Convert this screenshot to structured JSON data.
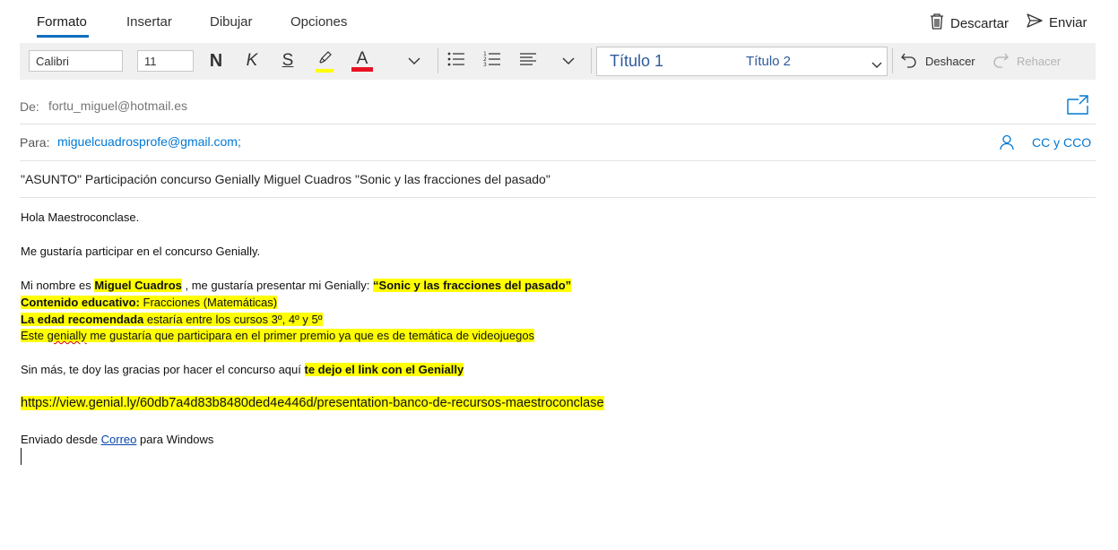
{
  "tabs": [
    {
      "label": "Formato",
      "active": true
    },
    {
      "label": "Insertar"
    },
    {
      "label": "Dibujar"
    },
    {
      "label": "Opciones"
    }
  ],
  "actions": {
    "discard": "Descartar",
    "send": "Enviar"
  },
  "toolbar": {
    "font_name": "Calibri",
    "font_size": "11",
    "bold_glyph": "N",
    "italic_glyph": "K",
    "underline_glyph": "S",
    "font_color_glyph": "A",
    "style_1": "Título 1",
    "style_2": "Título 2",
    "undo_label": "Deshacer",
    "redo_label": "Rehacer",
    "highlight_color": "#ffff00",
    "font_color": "#e81123"
  },
  "from": {
    "label": "De:",
    "value": "fortu_miguel@hotmail.es"
  },
  "to": {
    "label": "Para:",
    "value": "miguelcuadrosprofe@gmail.com;",
    "cc_label": "CC y CCO"
  },
  "subject": "\"ASUNTO\" Participación concurso Genially Miguel Cuadros \"Sonic y las fracciones del pasado\"",
  "body": {
    "greeting": "Hola Maestroconclase.",
    "line1": "Me gustaría participar en el concurso Genially.",
    "line2_a": "Mi nombre es ",
    "line2_name": "Miguel Cuadros",
    "line2_b": " , me gustaría presentar mi Genially: ",
    "line2_title": "“Sonic y las fracciones del pasado”",
    "line3_bold": "Contenido educativo:",
    "line3_rest": " Fracciones (Matemáticas)",
    "line4_bold": "La edad recomendada",
    "line4_rest": " estaría entre los cursos 3º, 4º y 5º",
    "line5_a": "Este ",
    "line5_spell": "genially",
    "line5_b": " me gustaría que participara en el primer premio ya que es de temática de videojuegos",
    "line6_a": "Sin más, te doy las gracias por hacer el concurso aquí ",
    "line6_bold": "te dejo el link con el Genially",
    "url": "https://view.genial.ly/60db7a4d83b8480ded4e446d/presentation-banco-de-recursos-maestroconclase",
    "sig_a": "Enviado desde ",
    "sig_link": "Correo",
    "sig_b": " para Windows"
  },
  "colors": {
    "accent": "#106ebe",
    "link": "#0078d4",
    "highlight": "#ffff00"
  }
}
